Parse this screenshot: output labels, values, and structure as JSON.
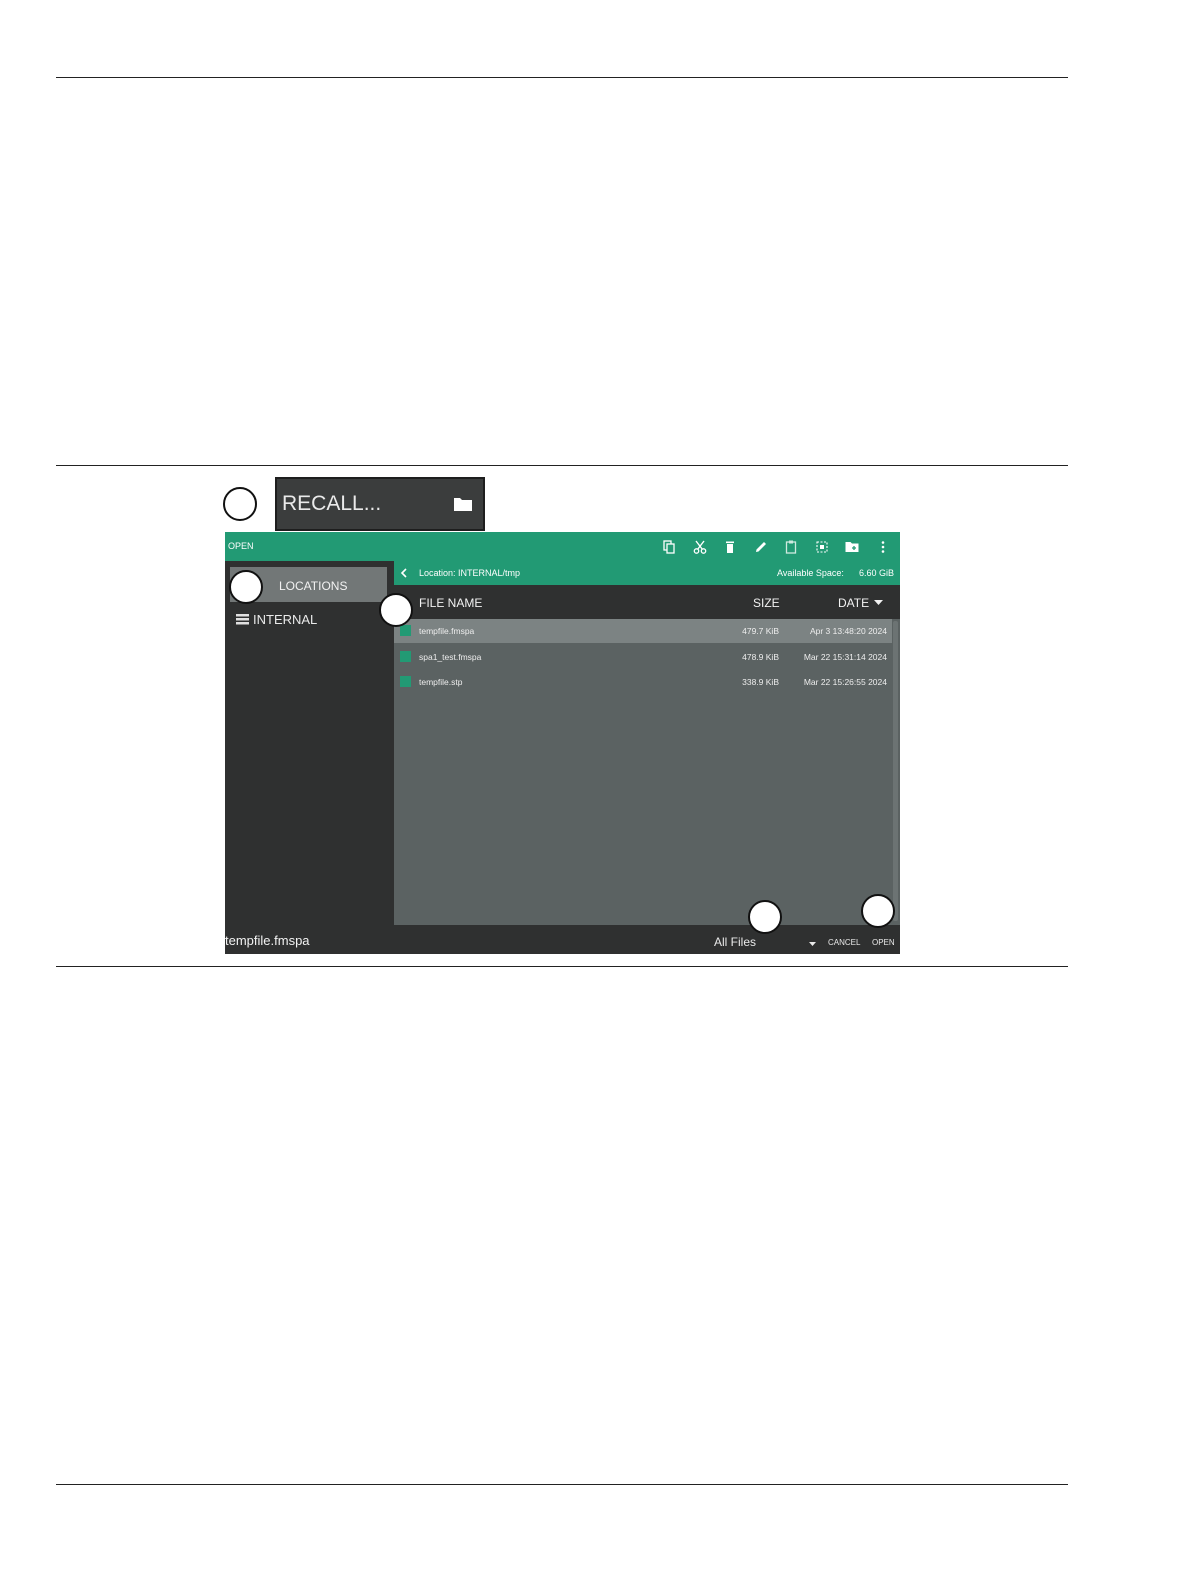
{
  "recall_button": {
    "label": "RECALL...",
    "icon": "folder-icon"
  },
  "dialog": {
    "title": "OPEN",
    "accent_color": "#229a74",
    "toolbar_icons": [
      "copy-icon",
      "cut-icon",
      "delete-icon",
      "rename-icon",
      "paste-icon",
      "select-all-icon",
      "new-folder-icon",
      "more-icon"
    ],
    "sidebar": {
      "locations_label": "LOCATIONS",
      "items": [
        {
          "label": "INTERNAL",
          "icon": "storage-icon"
        }
      ]
    },
    "location_bar": {
      "path": "Location: INTERNAL/tmp",
      "available_label": "Available Space:",
      "available_value": "6.60 GiB"
    },
    "columns": {
      "name": "FILE NAME",
      "size": "SIZE",
      "date": "DATE"
    },
    "files": [
      {
        "name": "tempfile.fmspa",
        "size": "479.7 KiB",
        "date": "Apr 3 13:48:20 2024",
        "icon": "measurement-file-icon",
        "selected": true
      },
      {
        "name": "spa1_test.fmspa",
        "size": "478.9 KiB",
        "date": "Mar 22 15:31:14 2024",
        "icon": "measurement-file-icon",
        "selected": false
      },
      {
        "name": "tempfile.stp",
        "size": "338.9 KiB",
        "date": "Mar 22 15:26:55 2024",
        "icon": "setup-file-icon",
        "selected": false
      }
    ],
    "bottom": {
      "current_file": "tempfile.fmspa",
      "filter": "All Files",
      "cancel_label": "CANCEL",
      "open_label": "OPEN"
    }
  }
}
